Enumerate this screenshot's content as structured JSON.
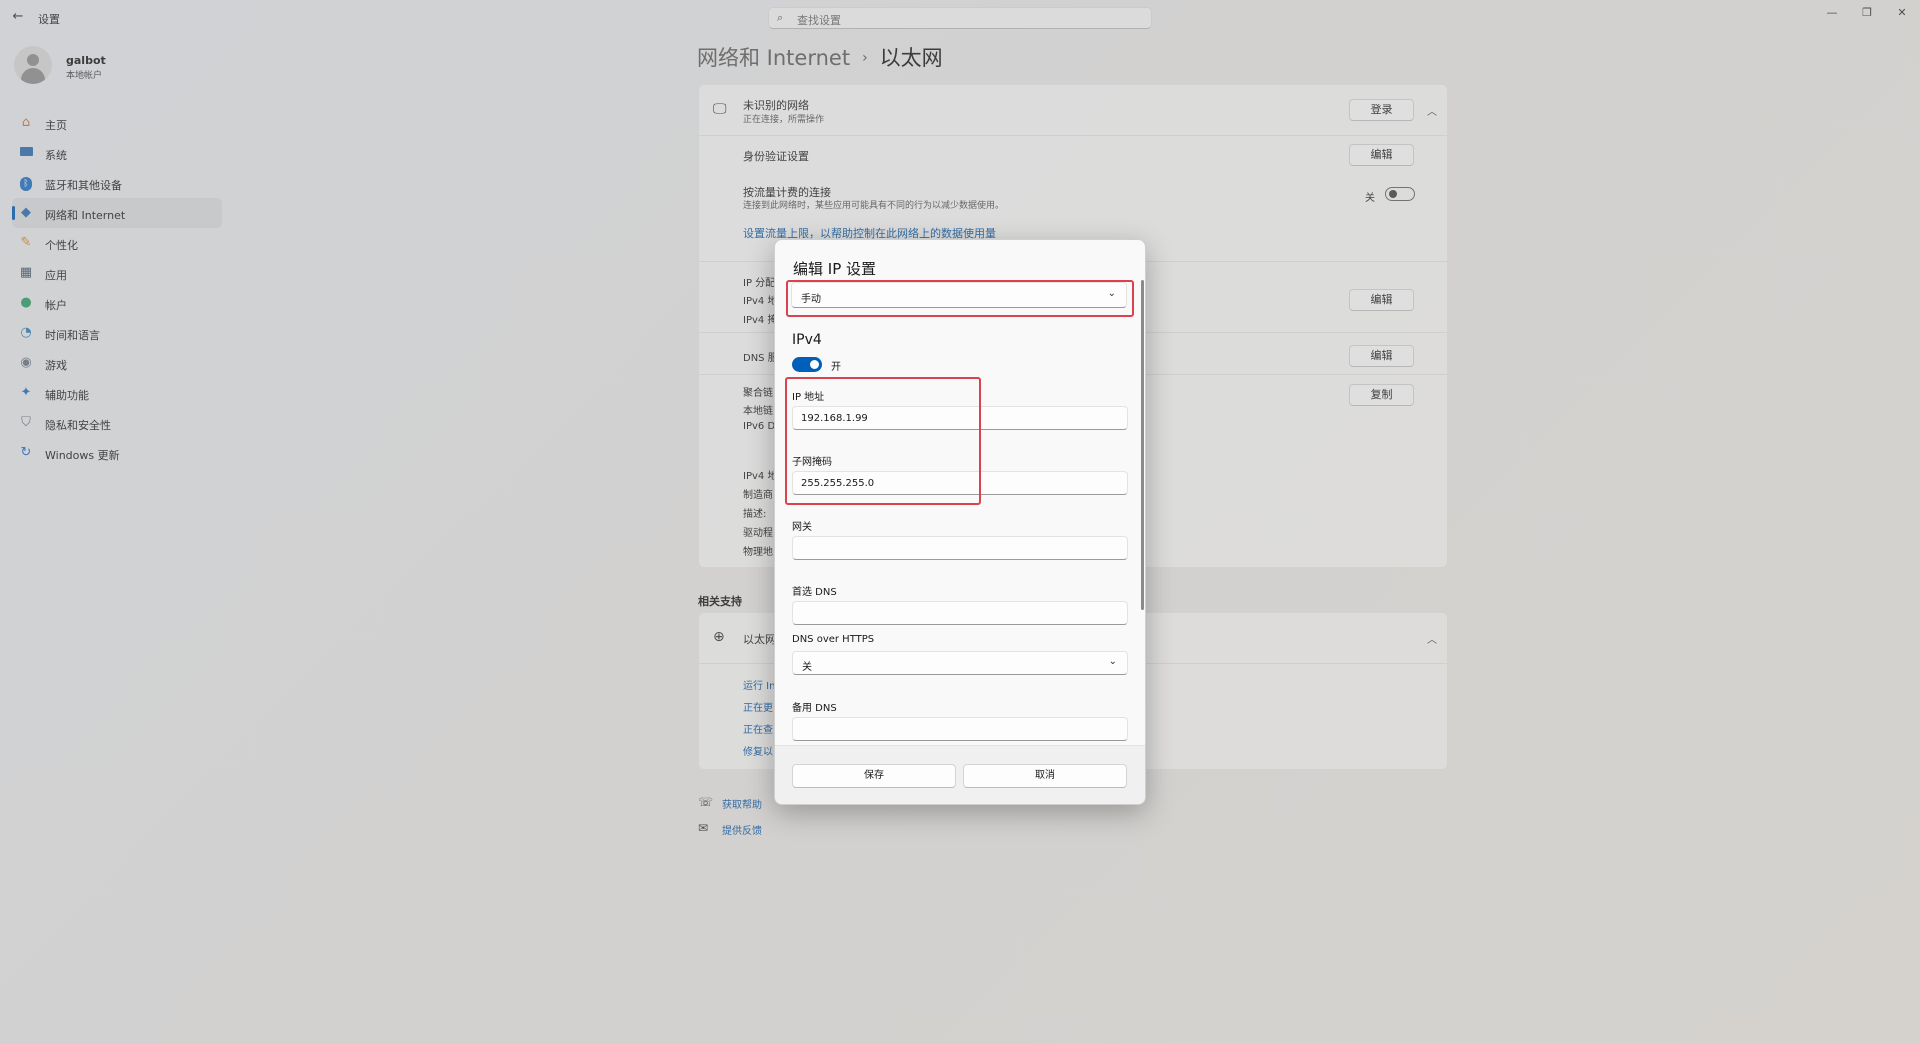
{
  "app": {
    "title": "设置"
  },
  "search": {
    "placeholder": "查找设置"
  },
  "profile": {
    "name": "galbot",
    "subtitle": "本地帐户"
  },
  "sidebar": {
    "items": [
      {
        "label": "主页",
        "icon": "home-icon"
      },
      {
        "label": "系统",
        "icon": "system-icon"
      },
      {
        "label": "蓝牙和其他设备",
        "icon": "bluetooth-icon"
      },
      {
        "label": "网络和 Internet",
        "icon": "network-icon",
        "active": true
      },
      {
        "label": "个性化",
        "icon": "brush-icon"
      },
      {
        "label": "应用",
        "icon": "apps-icon"
      },
      {
        "label": "帐户",
        "icon": "account-icon"
      },
      {
        "label": "时间和语言",
        "icon": "globe-clock-icon"
      },
      {
        "label": "游戏",
        "icon": "gamepad-icon"
      },
      {
        "label": "辅助功能",
        "icon": "accessibility-icon"
      },
      {
        "label": "隐私和安全性",
        "icon": "shield-icon"
      },
      {
        "label": "Windows 更新",
        "icon": "update-icon"
      }
    ]
  },
  "breadcrumb": {
    "parent": "网络和 Internet",
    "separator": "›",
    "current": "以太网"
  },
  "network": {
    "name": "未识别的网络",
    "status": "正在连接，所需操作",
    "login_button": "登录",
    "auth_label": "身份验证设置",
    "edit_button": "编辑",
    "metered_label": "按流量计费的连接",
    "metered_desc": "连接到此网络时，某些应用可能具有不同的行为以减少数据使用。",
    "metered_state": "关",
    "data_limit_link": "设置流量上限，以帮助控制在此网络上的数据使用量",
    "ip_rows": [
      "IP 分配",
      "IPv4 地",
      "IPv4 掩"
    ],
    "dns_row": "DNS 服",
    "props_rows": [
      "聚合链",
      "本地链",
      "IPv6 D"
    ],
    "adapter_rows": [
      "IPv4 地",
      "制造商",
      "描述:",
      "驱动程",
      "物理地"
    ],
    "copy_button": "复制"
  },
  "related": {
    "title": "相关支持",
    "card_label": "以太网",
    "links": [
      "运行 In",
      "正在更",
      "正在查",
      "修复以"
    ]
  },
  "help": {
    "get_help": "获取帮助",
    "feedback": "提供反馈"
  },
  "dialog": {
    "title": "编辑 IP 设置",
    "mode": "手动",
    "ipv4_heading": "IPv4",
    "ipv4_toggle": "开",
    "ip_label": "IP 地址",
    "ip_value": "192.168.1.99",
    "mask_label": "子网掩码",
    "mask_value": "255.255.255.0",
    "gateway_label": "网关",
    "gateway_value": "",
    "dns_label": "首选 DNS",
    "dns_value": "",
    "doh_label": "DNS over HTTPS",
    "doh_value": "关",
    "alt_dns_label": "备用 DNS",
    "save": "保存",
    "cancel": "取消"
  },
  "colors": {
    "accent": "#005fb8",
    "highlight": "#d9434e",
    "link": "#0f5ca8"
  }
}
